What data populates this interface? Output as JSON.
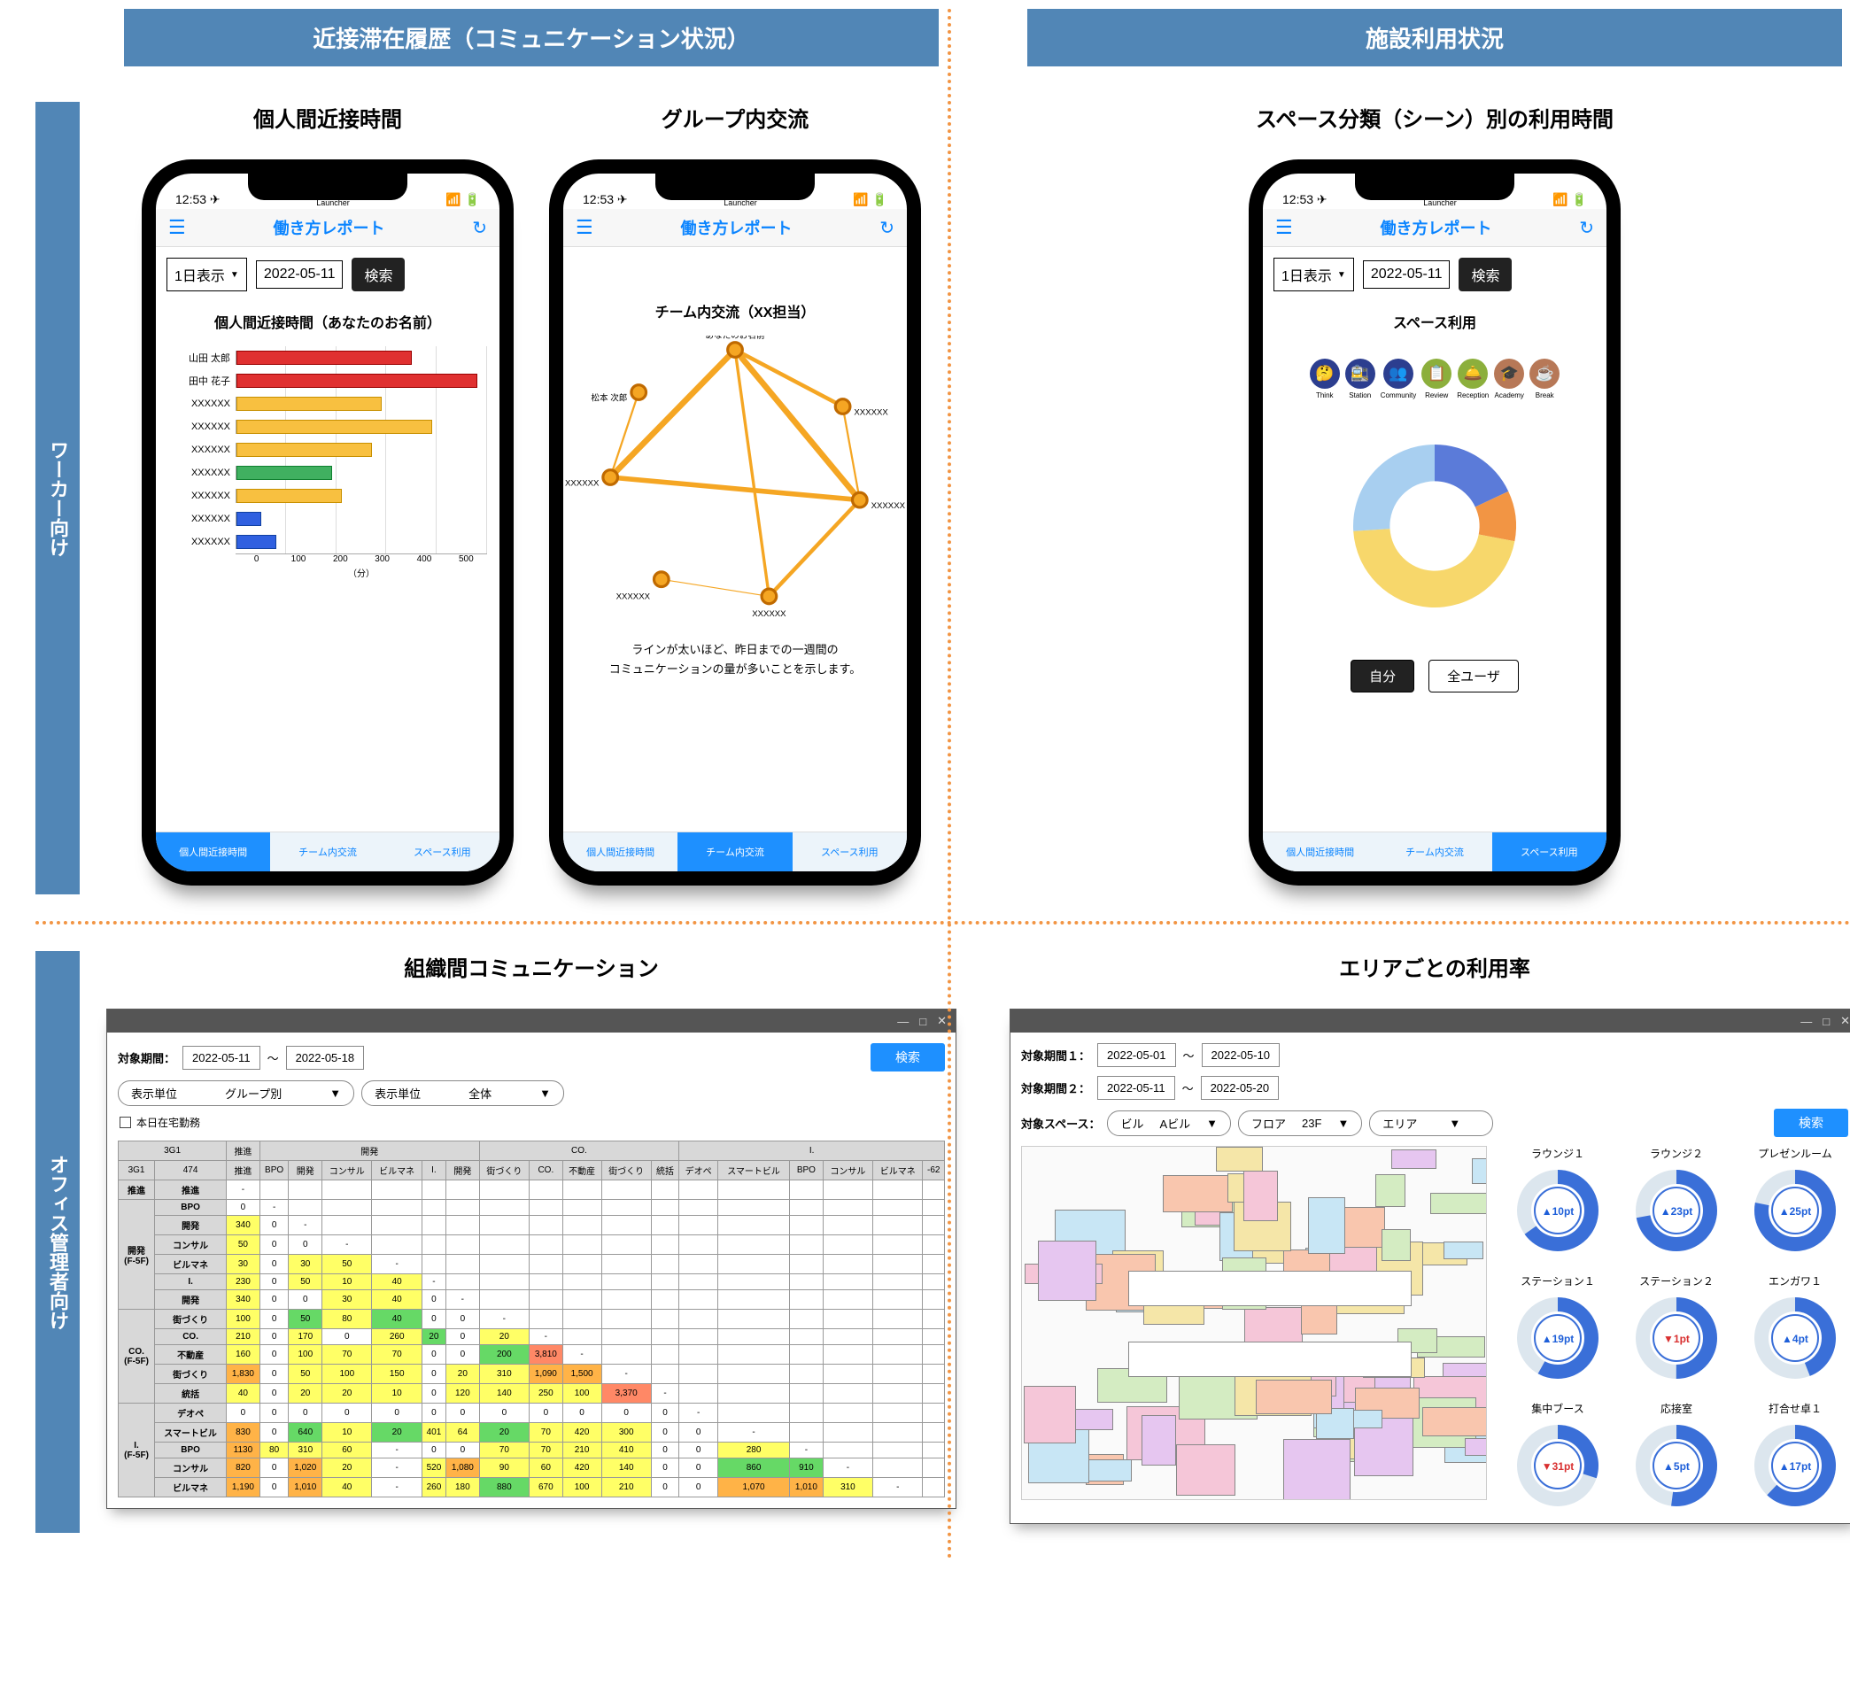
{
  "headers": {
    "left": "近接滞在履歴（コミュニケーション状況）",
    "right": "施設利用状況"
  },
  "side": {
    "worker": "ワーカー向け",
    "admin": "オフィス管理者向け"
  },
  "subtitles": {
    "p1": "個人間近接時間",
    "p2": "グループ内交流",
    "p3": "スペース分類（シーン）別の利用時間",
    "w1": "組織間コミュニケーション",
    "w2": "エリアごとの利用率"
  },
  "phone": {
    "time": "12:53",
    "launcher": "Launcher",
    "app_title": "働き方レポート",
    "mode": "1日表示",
    "date": "2022-05-11",
    "search": "検索",
    "tabs": [
      "個人間近接時間",
      "チーム内交流",
      "スペース利用"
    ]
  },
  "chart_data": [
    {
      "type": "bar",
      "title": "個人間近接時間（あなたのお名前）",
      "orientation": "horizontal",
      "xlabel": "（分）",
      "xlim": [
        0,
        500
      ],
      "xticks": [
        0,
        100,
        200,
        300,
        400,
        500
      ],
      "series_key": "color",
      "categories": [
        "山田 太郎",
        "田中 花子",
        "XXXXXX",
        "XXXXXX",
        "XXXXXX",
        "XXXXXX",
        "XXXXXX",
        "XXXXXX",
        "XXXXXX"
      ],
      "values": [
        350,
        480,
        290,
        390,
        270,
        190,
        210,
        50,
        80
      ],
      "colors": [
        "r",
        "r",
        "y",
        "y",
        "y",
        "g",
        "y",
        "b",
        "b"
      ]
    },
    {
      "type": "network",
      "title": "チーム内交流（XX担当）",
      "note": "ラインが太いほど、昨日までの一週間の\nコミュニケーションの量が多いことを示します。",
      "nodes": [
        "あなたのお名前",
        "XXXXXX",
        "XXXXXX",
        "XXXXXX",
        "XXXXXX",
        "XXXXXX",
        "松本 次郎"
      ],
      "node_pos": [
        [
          0.5,
          0.05
        ],
        [
          0.88,
          0.25
        ],
        [
          0.94,
          0.58
        ],
        [
          0.62,
          0.92
        ],
        [
          0.24,
          0.86
        ],
        [
          0.06,
          0.5
        ],
        [
          0.16,
          0.2
        ]
      ],
      "edges": [
        [
          0,
          1,
          4
        ],
        [
          0,
          2,
          6
        ],
        [
          0,
          3,
          3
        ],
        [
          0,
          5,
          6
        ],
        [
          1,
          2,
          2
        ],
        [
          2,
          3,
          4
        ],
        [
          2,
          5,
          5
        ],
        [
          3,
          4,
          1
        ],
        [
          5,
          6,
          2
        ]
      ]
    },
    {
      "type": "pie",
      "title": "スペース利用",
      "donut": true,
      "categories": [
        "Think",
        "Station",
        "Community",
        "Review",
        "Reception",
        "Academy",
        "Break"
      ],
      "icon_colors": [
        "#2C3E8F",
        "#2C3E8F",
        "#2C3E8F",
        "#8CAF3C",
        "#8CAF3C",
        "#B77857",
        "#B77857"
      ],
      "slices": [
        {
          "label": "Think",
          "value": 18,
          "color": "#5B7BD9"
        },
        {
          "label": "Station",
          "value": 10,
          "color": "#F29544"
        },
        {
          "label": "Community",
          "value": 46,
          "color": "#F7D76B"
        },
        {
          "label": "Review",
          "value": 26,
          "color": "#A8CFF0"
        }
      ],
      "toggles": [
        "自分",
        "全ユーザ"
      ]
    }
  ],
  "win_common": {
    "min": "—",
    "max": "□",
    "close": "✕"
  },
  "win1": {
    "period_label": "対象期間：",
    "from": "2022-05-11",
    "tilde": "〜",
    "to": "2022-05-18",
    "search": "検索",
    "unit_label": "表示単位",
    "unit1": "グループ別",
    "unit2": "全体",
    "checkbox": "本日在宅勤務",
    "groups_top": [
      "推進",
      "開発",
      "CO.",
      "I."
    ],
    "cols": [
      "推進",
      "BPO",
      "開発",
      "コンサル",
      "ビルマネ",
      "I.",
      "開発",
      "街づくり",
      "CO.",
      "不動産",
      "街づくり",
      "統括",
      "デオペ",
      "スマートビル",
      "BPO",
      "コンサル",
      "ビルマネ",
      "-62"
    ],
    "row_groups": [
      {
        "name": "推進",
        "span": 1,
        "rows": [
          {
            "name": "推進",
            "vals": [
              "-",
              "",
              "",
              "",
              "",
              "",
              "",
              "",
              "",
              "",
              "",
              "",
              "",
              "",
              "",
              "",
              "",
              ""
            ]
          }
        ]
      },
      {
        "name": "開発\n(F-5F)",
        "span": 6,
        "rows": [
          {
            "name": "BPO",
            "vals": [
              "0",
              "-",
              "",
              "",
              "",
              "",
              "",
              "",
              "",
              "",
              "",
              "",
              "",
              "",
              "",
              "",
              "",
              ""
            ]
          },
          {
            "name": "開発",
            "vals": [
              {
                "v": "340",
                "c": "y"
              },
              "0",
              "-",
              "",
              "",
              "",
              "",
              "",
              "",
              "",
              "",
              "",
              "",
              "",
              "",
              "",
              "",
              ""
            ]
          },
          {
            "name": "コンサル",
            "vals": [
              {
                "v": "50",
                "c": "y"
              },
              "0",
              "0",
              "-",
              "",
              "",
              "",
              "",
              "",
              "",
              "",
              "",
              "",
              "",
              "",
              "",
              "",
              ""
            ]
          },
          {
            "name": "ビルマネ",
            "vals": [
              {
                "v": "30",
                "c": "y"
              },
              "0",
              {
                "v": "30",
                "c": "y"
              },
              {
                "v": "50",
                "c": "y"
              },
              "-",
              "",
              "",
              "",
              "",
              "",
              "",
              "",
              "",
              "",
              "",
              "",
              "",
              ""
            ]
          },
          {
            "name": "I.",
            "vals": [
              {
                "v": "230",
                "c": "y"
              },
              "0",
              {
                "v": "50",
                "c": "y"
              },
              {
                "v": "10",
                "c": "y"
              },
              {
                "v": "40",
                "c": "y"
              },
              "-",
              "",
              "",
              "",
              "",
              "",
              "",
              "",
              "",
              "",
              "",
              "",
              ""
            ]
          },
          {
            "name": "開発",
            "vals": [
              {
                "v": "340",
                "c": "y"
              },
              "0",
              "0",
              {
                "v": "30",
                "c": "y"
              },
              {
                "v": "40",
                "c": "y"
              },
              "0",
              "-",
              "",
              "",
              "",
              "",
              "",
              "",
              "",
              "",
              "",
              "",
              ""
            ]
          }
        ]
      },
      {
        "name": "CO.\n(F-5F)",
        "span": 4,
        "rows": [
          {
            "name": "街づくり",
            "vals": [
              {
                "v": "100",
                "c": "y"
              },
              "0",
              {
                "v": "50",
                "c": "g"
              },
              {
                "v": "80",
                "c": "y"
              },
              {
                "v": "40",
                "c": "g"
              },
              "0",
              "0",
              "-",
              "",
              "",
              "",
              "",
              "",
              "",
              "",
              "",
              "",
              ""
            ]
          },
          {
            "name": "CO.",
            "vals": [
              {
                "v": "210",
                "c": "y"
              },
              "0",
              {
                "v": "170",
                "c": "y"
              },
              "0",
              {
                "v": "260",
                "c": "y"
              },
              {
                "v": "20",
                "c": "g"
              },
              "0",
              {
                "v": "20",
                "c": "y"
              },
              "-",
              "",
              "",
              "",
              "",
              "",
              "",
              "",
              "",
              ""
            ]
          },
          {
            "name": "不動産",
            "vals": [
              {
                "v": "160",
                "c": "y"
              },
              "0",
              {
                "v": "100",
                "c": "y"
              },
              {
                "v": "70",
                "c": "y"
              },
              {
                "v": "70",
                "c": "y"
              },
              "0",
              "0",
              {
                "v": "200",
                "c": "g"
              },
              {
                "v": "3,810",
                "c": "r"
              },
              "-",
              "",
              "",
              "",
              "",
              "",
              "",
              "",
              ""
            ]
          },
          {
            "name": "街づくり",
            "vals": [
              {
                "v": "1,830",
                "c": "o"
              },
              "0",
              {
                "v": "50",
                "c": "y"
              },
              {
                "v": "100",
                "c": "y"
              },
              {
                "v": "150",
                "c": "y"
              },
              "0",
              {
                "v": "20",
                "c": "y"
              },
              {
                "v": "310",
                "c": "y"
              },
              {
                "v": "1,090",
                "c": "o"
              },
              {
                "v": "1,500",
                "c": "o"
              },
              "-",
              "",
              "",
              "",
              "",
              "",
              "",
              ""
            ]
          },
          {
            "name": "統括",
            "vals": [
              {
                "v": "40",
                "c": "y"
              },
              "0",
              {
                "v": "20",
                "c": "y"
              },
              {
                "v": "20",
                "c": "y"
              },
              {
                "v": "10",
                "c": "y"
              },
              "0",
              {
                "v": "120",
                "c": "y"
              },
              {
                "v": "140",
                "c": "y"
              },
              {
                "v": "250",
                "c": "y"
              },
              {
                "v": "100",
                "c": "y"
              },
              {
                "v": "3,370",
                "c": "r"
              },
              "-",
              "",
              "",
              "",
              "",
              "",
              ""
            ]
          }
        ]
      },
      {
        "name": "I.\n(F-5F)",
        "span": 6,
        "rows": [
          {
            "name": "デオペ",
            "vals": [
              "0",
              "0",
              "0",
              "0",
              "0",
              "0",
              "0",
              "0",
              "0",
              "0",
              "0",
              "0",
              "-",
              "",
              "",
              "",
              "",
              ""
            ]
          },
          {
            "name": "スマートビル",
            "vals": [
              {
                "v": "830",
                "c": "o"
              },
              "0",
              {
                "v": "640",
                "c": "g"
              },
              {
                "v": "10",
                "c": "y"
              },
              {
                "v": "20",
                "c": "g"
              },
              {
                "v": "401",
                "c": "y"
              },
              {
                "v": "64",
                "c": "y"
              },
              {
                "v": "20",
                "c": "g"
              },
              {
                "v": "70",
                "c": "y"
              },
              {
                "v": "420",
                "c": "y"
              },
              {
                "v": "300",
                "c": "y"
              },
              "0",
              "0",
              "-",
              "",
              "",
              "",
              ""
            ]
          },
          {
            "name": "BPO",
            "vals": [
              {
                "v": "1130",
                "c": "o"
              },
              {
                "v": "80",
                "c": "y"
              },
              {
                "v": "310",
                "c": "y"
              },
              {
                "v": "60",
                "c": "y"
              },
              "-",
              "0",
              "0",
              {
                "v": "70",
                "c": "y"
              },
              {
                "v": "70",
                "c": "y"
              },
              {
                "v": "210",
                "c": "y"
              },
              {
                "v": "410",
                "c": "y"
              },
              "0",
              "0",
              {
                "v": "280",
                "c": "y"
              },
              "-",
              "",
              "",
              ""
            ]
          },
          {
            "name": "コンサル",
            "vals": [
              {
                "v": "820",
                "c": "o"
              },
              "0",
              {
                "v": "1,020",
                "c": "o"
              },
              {
                "v": "20",
                "c": "y"
              },
              "-",
              {
                "v": "520",
                "c": "y"
              },
              {
                "v": "1,080",
                "c": "o"
              },
              {
                "v": "90",
                "c": "y"
              },
              {
                "v": "60",
                "c": "y"
              },
              {
                "v": "420",
                "c": "y"
              },
              {
                "v": "140",
                "c": "y"
              },
              "0",
              "0",
              {
                "v": "860",
                "c": "g"
              },
              {
                "v": "910",
                "c": "g"
              },
              "-",
              "",
              ""
            ]
          },
          {
            "name": "ビルマネ",
            "vals": [
              {
                "v": "1,190",
                "c": "o"
              },
              "0",
              {
                "v": "1,010",
                "c": "o"
              },
              {
                "v": "40",
                "c": "y"
              },
              "-",
              {
                "v": "260",
                "c": "y"
              },
              {
                "v": "180",
                "c": "y"
              },
              {
                "v": "880",
                "c": "g"
              },
              {
                "v": "670",
                "c": "y"
              },
              {
                "v": "100",
                "c": "y"
              },
              {
                "v": "210",
                "c": "y"
              },
              "0",
              "0",
              {
                "v": "1,070",
                "c": "o"
              },
              {
                "v": "1,010",
                "c": "o"
              },
              {
                "v": "310",
                "c": "y"
              },
              "-",
              ""
            ]
          }
        ]
      }
    ],
    "totals_row1": [
      "3G1",
      "推進",
      "開発",
      "CO.",
      "I."
    ],
    "totals_row2": [
      "3G1",
      "474"
    ]
  },
  "win2": {
    "p1_label": "対象期間１：",
    "p1_from": "2022-05-01",
    "p1_to": "2022-05-10",
    "p2_label": "対象期間２：",
    "p2_from": "2022-05-11",
    "p2_to": "2022-05-20",
    "tilde": "〜",
    "space_label": "対象スペース：",
    "space_bldg": "ビル",
    "space_bldg_v": "Aビル",
    "space_floor": "フロア",
    "space_floor_v": "23F",
    "space_area": "エリア",
    "space_area_v": "",
    "search": "検索",
    "gauges": [
      {
        "name": "ラウンジ１",
        "delta": "+10",
        "dir": "up",
        "pct": 65
      },
      {
        "name": "ラウンジ２",
        "delta": "+23",
        "dir": "up",
        "pct": 72
      },
      {
        "name": "プレゼンルーム",
        "delta": "+25",
        "dir": "up",
        "pct": 78
      },
      {
        "name": "ステーション１",
        "delta": "+19",
        "dir": "up",
        "pct": 58
      },
      {
        "name": "ステーション２",
        "delta": "-1",
        "dir": "dn",
        "pct": 50
      },
      {
        "name": "エンガワ１",
        "delta": "+4",
        "dir": "up",
        "pct": 44
      },
      {
        "name": "集中ブース",
        "delta": "-31",
        "dir": "dn",
        "pct": 30
      },
      {
        "name": "応接室",
        "delta": "+5",
        "dir": "up",
        "pct": 52
      },
      {
        "name": "打合せ卓１",
        "delta": "+17",
        "dir": "up",
        "pct": 62
      }
    ]
  }
}
